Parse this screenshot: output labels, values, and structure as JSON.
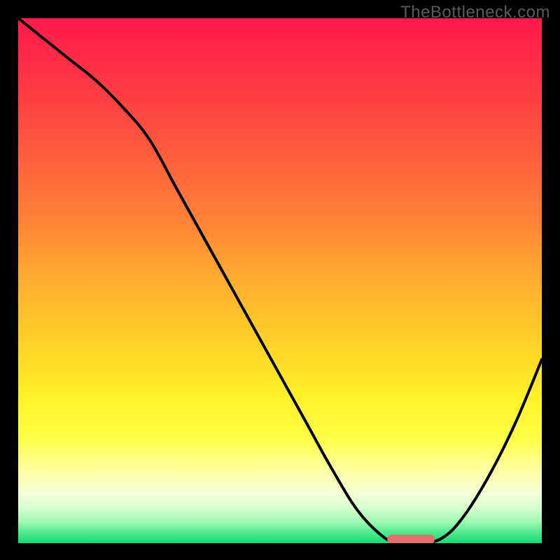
{
  "watermark": "TheBottleneck.com",
  "colors": {
    "background": "#000000",
    "curve": "#000000",
    "marker_fill": "#e56f6c",
    "gradient_stops": [
      {
        "offset": 0.0,
        "color": "#ff1a4a"
      },
      {
        "offset": 0.12,
        "color": "#ff3545"
      },
      {
        "offset": 0.25,
        "color": "#ff5a3e"
      },
      {
        "offset": 0.38,
        "color": "#ff8036"
      },
      {
        "offset": 0.5,
        "color": "#ffae2f"
      },
      {
        "offset": 0.62,
        "color": "#ffd228"
      },
      {
        "offset": 0.72,
        "color": "#fff127"
      },
      {
        "offset": 0.8,
        "color": "#ffff47"
      },
      {
        "offset": 0.86,
        "color": "#feffa0"
      },
      {
        "offset": 0.905,
        "color": "#f6ffd8"
      },
      {
        "offset": 0.935,
        "color": "#d4ffcf"
      },
      {
        "offset": 0.96,
        "color": "#9cf8b0"
      },
      {
        "offset": 0.98,
        "color": "#4fe88c"
      },
      {
        "offset": 1.0,
        "color": "#13db71"
      }
    ]
  },
  "chart_data": {
    "type": "line",
    "title": "",
    "xlabel": "",
    "ylabel": "",
    "xlim": [
      0,
      100
    ],
    "ylim": [
      0,
      100
    ],
    "x": [
      0,
      5,
      10,
      15,
      20,
      25,
      30,
      35,
      40,
      45,
      50,
      55,
      60,
      65,
      70,
      73,
      77,
      81,
      85,
      90,
      95,
      100
    ],
    "y": [
      100,
      96,
      92,
      88,
      83,
      77,
      68,
      59,
      50,
      41,
      32,
      23,
      14,
      6,
      1,
      0,
      0,
      1,
      5,
      13,
      23,
      35
    ],
    "marker": {
      "x_center": 75,
      "width": 9,
      "y": 0.7,
      "height": 1.8
    }
  }
}
